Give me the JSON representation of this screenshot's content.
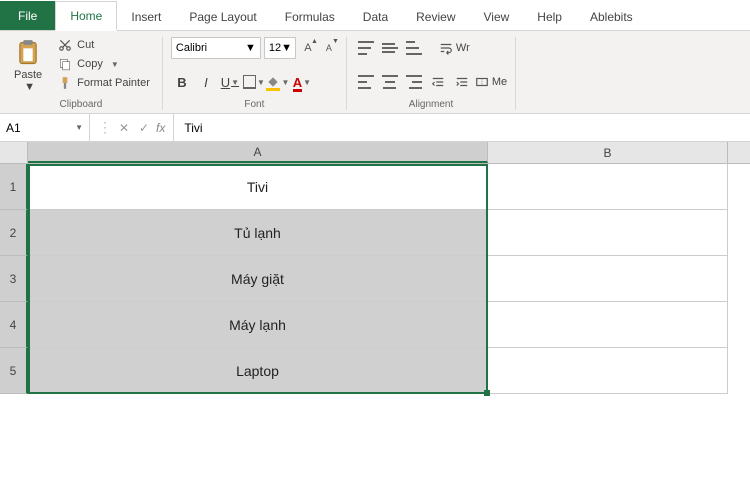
{
  "tabs": {
    "file": "File",
    "home": "Home",
    "insert": "Insert",
    "pagelayout": "Page Layout",
    "formulas": "Formulas",
    "data": "Data",
    "review": "Review",
    "view": "View",
    "help": "Help",
    "ablebits": "Ablebits"
  },
  "clipboard": {
    "paste": "Paste",
    "cut": "Cut",
    "copy": "Copy",
    "format_painter": "Format Painter",
    "label": "Clipboard"
  },
  "font": {
    "name": "Calibri",
    "size": "12",
    "bold": "B",
    "italic": "I",
    "underline": "U",
    "font_color_letter": "A",
    "label": "Font"
  },
  "alignment": {
    "wrap": "Wr",
    "merge": "Me",
    "label": "Alignment"
  },
  "namebox": "A1",
  "formula": "Tivi",
  "columns": {
    "a": "A",
    "b": "B"
  },
  "rows": {
    "r1": "1",
    "r2": "2",
    "r3": "3",
    "r4": "4",
    "r5": "5"
  },
  "cells": {
    "a1": "Tivi",
    "a2": "Tủ lạnh",
    "a3": "Máy giặt",
    "a4": "Máy lạnh",
    "a5": "Laptop"
  }
}
